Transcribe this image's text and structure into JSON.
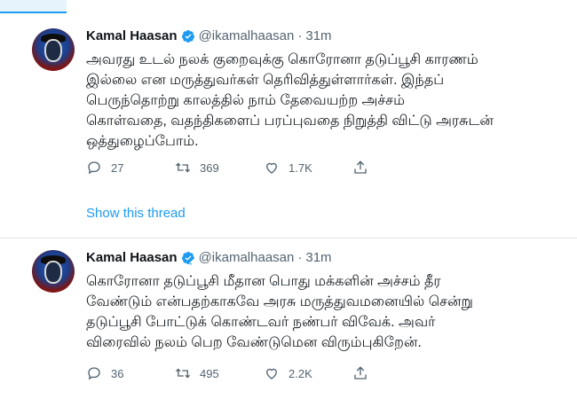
{
  "colors": {
    "accent": "#1d9bf0",
    "secondary_text": "#536471",
    "border": "#e1e8ed"
  },
  "tweets": [
    {
      "author_name": "Kamal Haasan",
      "handle": "@ikamalhaasan",
      "separator": "·",
      "time": "31m",
      "verified_icon": "verified-badge-icon",
      "text": "அவரது உடல் நலக் குறைவுக்கு கொரோனா தடுப்பூசி காரணம்\nஇல்லை என மருத்துவர்கள் தெரிவித்துள்ளார்கள். இந்தப்\nபெருந்தொற்று காலத்தில் நாம் தேவையற்ற அச்சம்\nகொள்வதை, வதந்திகளைப் பரப்புவதை நிறுத்தி விட்டு அரசுடன்\nஒத்துழைப்போம்.",
      "replies": "27",
      "retweets": "369",
      "likes": "1.7K",
      "show_thread": "Show this thread"
    },
    {
      "author_name": "Kamal Haasan",
      "handle": "@ikamalhaasan",
      "separator": "·",
      "time": "31m",
      "verified_icon": "verified-badge-icon",
      "text": "கொரோனா தடுப்பூசி மீதான பொது மக்களின் அச்சம் தீர\nவேண்டும் என்பதற்காகவே அரசு மருத்துவமனையில் சென்று\nதடுப்பூசி போட்டுக் கொண்டவர் நண்பர் விவேக். அவர்\nவிரைவில் நலம் பெற வேண்டுமென விரும்புகிறேன்.",
      "replies": "36",
      "retweets": "495",
      "likes": "2.2K"
    }
  ]
}
